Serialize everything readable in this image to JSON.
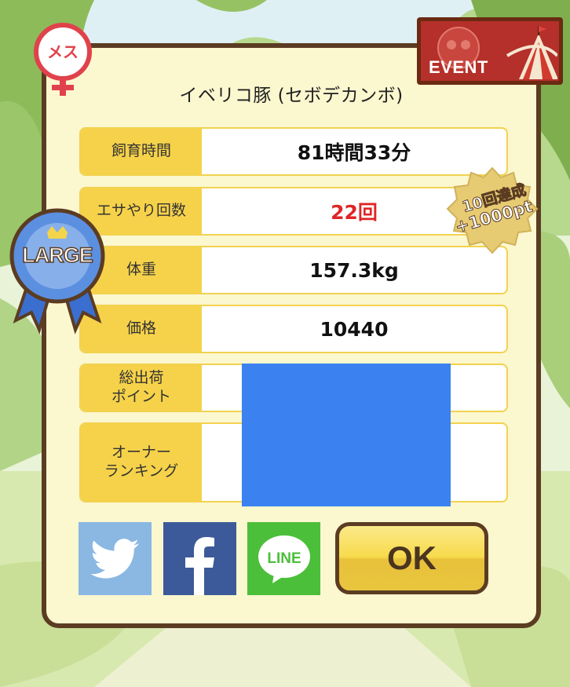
{
  "pig": {
    "name": "イベリコ豚 (セボデカンボ)",
    "gender_label": "メス",
    "size_badge": "LARGE"
  },
  "event_label": "EVENT",
  "bonus_badge": {
    "line1": "10回達成",
    "line2": "+1000pt"
  },
  "stats": [
    {
      "label": "飼育時間",
      "value": "81時間33分"
    },
    {
      "label": "エサやり回数",
      "value": "22回"
    },
    {
      "label": "体重",
      "value": "157.3kg"
    },
    {
      "label": "価格",
      "value": "10440"
    },
    {
      "label": "総出荷\nポイント",
      "value": ""
    },
    {
      "label": "オーナー\nランキング",
      "value": ""
    }
  ],
  "buttons": {
    "ok": "OK"
  },
  "share": {
    "line_label": "LINE"
  },
  "colors": {
    "frame": "#5b3c22",
    "label_bg": "#f6d24a",
    "highlight_value": "#e02525",
    "twitter": "#8ab8e3",
    "facebook": "#3c5a99",
    "line": "#4bbf3a"
  },
  "icons": [
    "female-icon",
    "large-ribbon-icon",
    "event-tent-icon",
    "twitter-icon",
    "facebook-icon",
    "line-icon",
    "bonus-badge-icon"
  ]
}
